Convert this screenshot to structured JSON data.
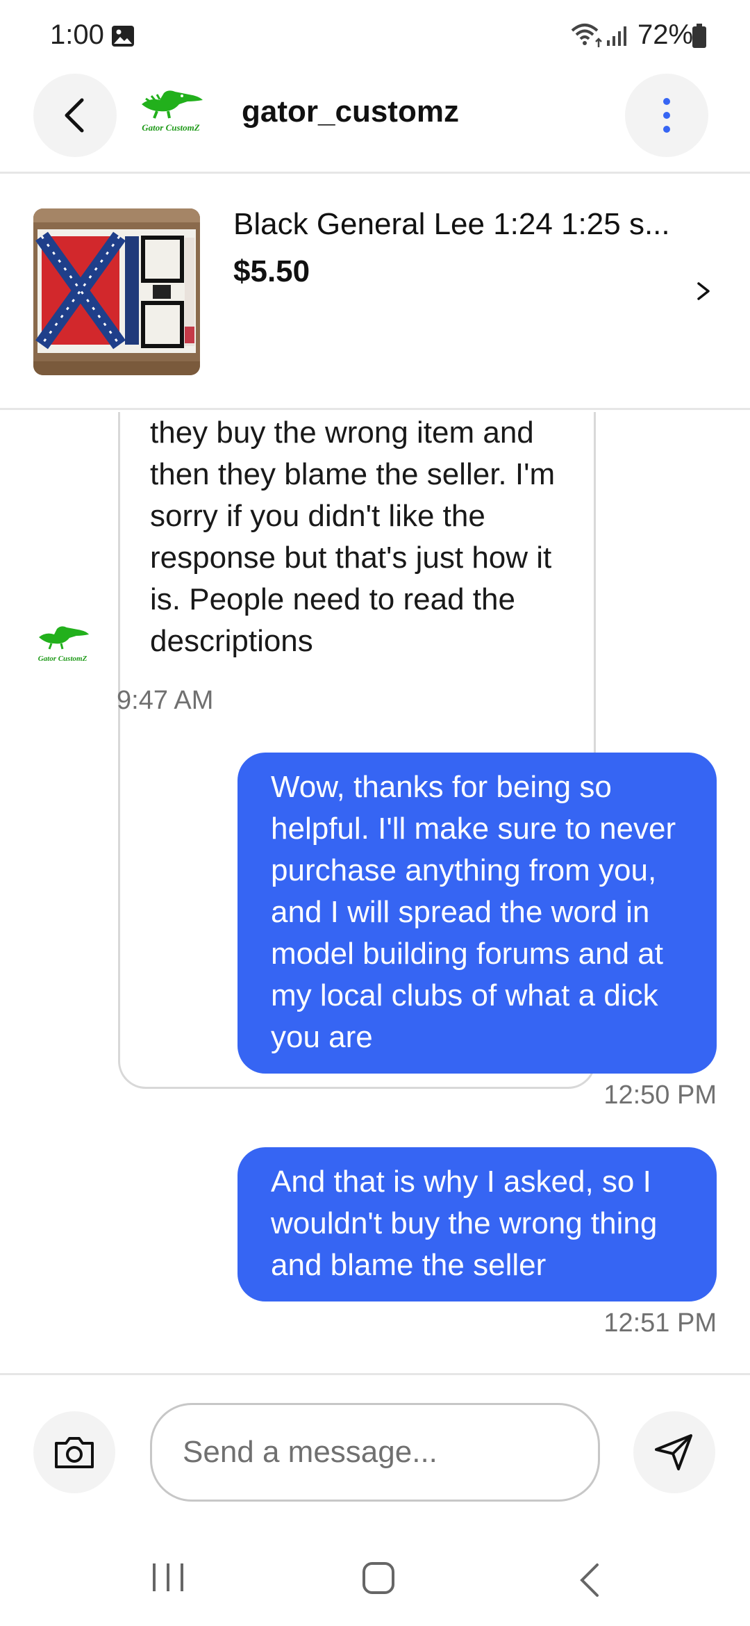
{
  "status_bar": {
    "time": "1:00",
    "battery": "72%"
  },
  "header": {
    "seller_name": "gator_customz",
    "seller_logo_text": "Gator CustomZ"
  },
  "item": {
    "title": "Black General Lee 1:24 1:25 s...",
    "price": "$5.50"
  },
  "messages": [
    {
      "direction": "incoming",
      "text": "they buy the wrong item and then they blame the seller. I'm sorry if you didn't like the response but that's just how it is. People need to read the descriptions",
      "timestamp": "9:47 AM"
    },
    {
      "direction": "outgoing",
      "text": "Wow, thanks for being so helpful. I'll make sure to never purchase anything from you, and I will spread the word in model building forums and at my local clubs of what a dick you are",
      "timestamp": "12:50 PM"
    },
    {
      "direction": "outgoing",
      "text": "And that is why I asked, so I wouldn't buy the wrong thing and blame the seller",
      "timestamp": "12:51 PM"
    }
  ],
  "composer": {
    "placeholder": "Send a message..."
  },
  "icons": {
    "back": "back-arrow-icon",
    "menu": "vertical-dots-icon",
    "camera": "camera-icon",
    "send": "send-icon",
    "chevron": "chevron-right-icon"
  },
  "colors": {
    "outgoing_bubble": "#3665f3",
    "logo_green": "#22b01c",
    "accent_blue": "#3665f3"
  }
}
